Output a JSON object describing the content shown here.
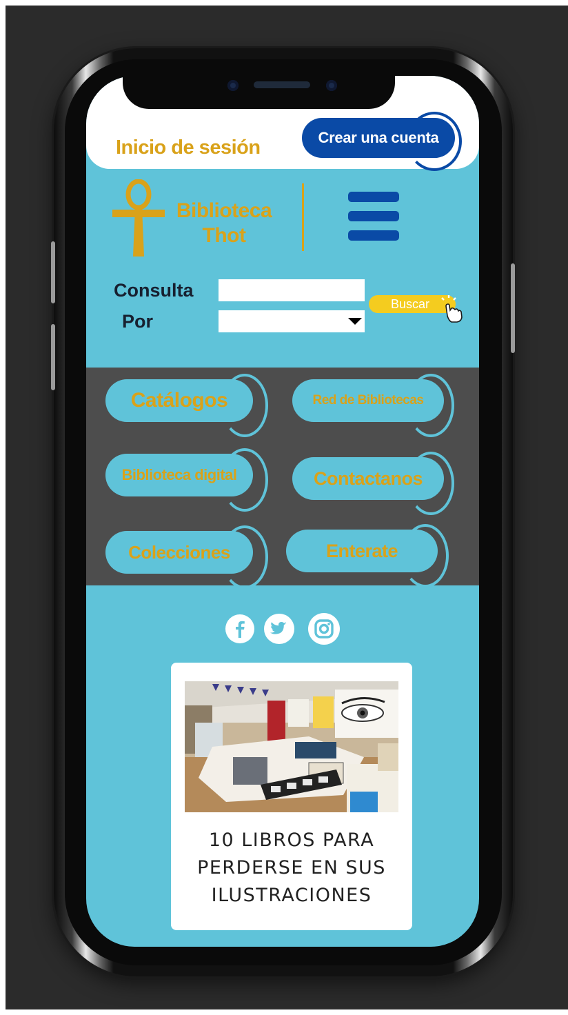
{
  "header": {
    "login_label": "Inicio de sesión",
    "create_account_label": "Crear una cuenta"
  },
  "brand": {
    "name_line1": "Biblioteca",
    "name_line2": "Thot",
    "icon": "ankh-icon"
  },
  "search": {
    "consulta_label": "Consulta",
    "por_label": "Por",
    "query_value": "",
    "por_value": "",
    "button_label": "Buscar"
  },
  "nav": {
    "items": [
      {
        "label": "Catálogos"
      },
      {
        "label": "Red de Bibliotecas"
      },
      {
        "label": "Biblioteca digital"
      },
      {
        "label": "Contactanos"
      },
      {
        "label": "Colecciones"
      },
      {
        "label": "Enterate"
      }
    ]
  },
  "social": {
    "icons": [
      "facebook-icon",
      "twitter-icon",
      "instagram-icon"
    ]
  },
  "article": {
    "title": "10 LIBROS PARA PERDERSE EN SUS ILUSTRACIONES"
  },
  "colors": {
    "primary_blue": "#0a4aa6",
    "accent_gold": "#d9a21a",
    "screen_cyan": "#5fc3d9",
    "panel_gray": "#4d4d4d",
    "search_yellow": "#f4cc1f"
  }
}
